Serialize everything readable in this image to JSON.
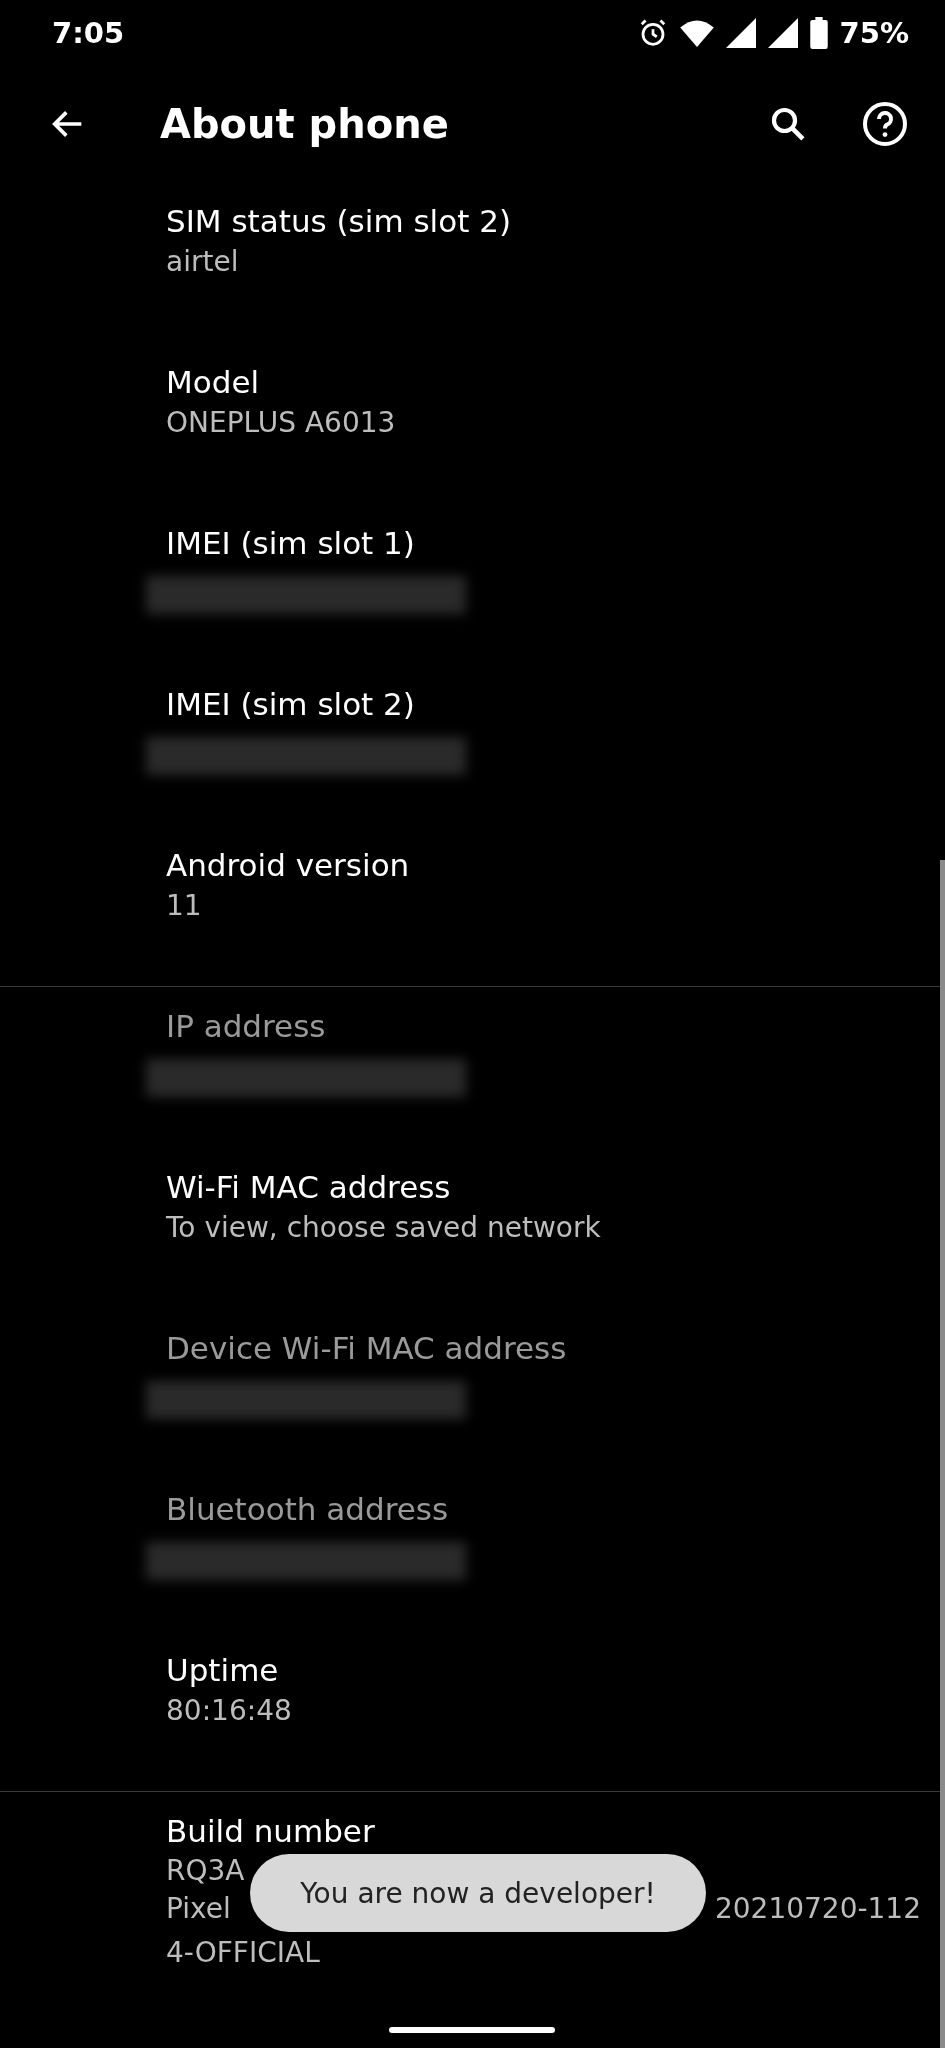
{
  "status_bar": {
    "time": "7:05",
    "battery": "75%"
  },
  "app_bar": {
    "title": "About phone"
  },
  "sections": [
    {
      "items": [
        {
          "title": "SIM status (sim slot 2)",
          "kind": "text",
          "disabled": false,
          "lines": [
            "airtel"
          ]
        },
        {
          "title": "Model",
          "kind": "text",
          "disabled": false,
          "lines": [
            "ONEPLUS A6013"
          ]
        },
        {
          "title": "IMEI (sim slot 1)",
          "kind": "redacted",
          "disabled": false
        },
        {
          "title": "IMEI (sim slot 2)",
          "kind": "redacted",
          "disabled": false
        },
        {
          "title": "Android version",
          "kind": "text",
          "disabled": false,
          "lines": [
            "11"
          ]
        }
      ]
    },
    {
      "items": [
        {
          "title": "IP address",
          "kind": "redacted",
          "disabled": true
        },
        {
          "title": "Wi-Fi MAC address",
          "kind": "text",
          "disabled": false,
          "lines": [
            "To view, choose saved network"
          ]
        },
        {
          "title": "Device Wi-Fi MAC address",
          "kind": "redacted",
          "disabled": true
        },
        {
          "title": "Bluetooth address",
          "kind": "redacted",
          "disabled": true
        },
        {
          "title": "Uptime",
          "kind": "text",
          "disabled": false,
          "lines": [
            "80:16:48"
          ]
        }
      ]
    },
    {
      "items": [
        {
          "title": "Build number",
          "kind": "segments",
          "disabled": false,
          "rows": [
            [
              "RQ3A"
            ],
            [
              "Pixel",
              "20210720-112"
            ],
            [
              "4-OFFICIAL"
            ]
          ]
        }
      ]
    }
  ],
  "toast": {
    "message": "You are now a developer!"
  }
}
